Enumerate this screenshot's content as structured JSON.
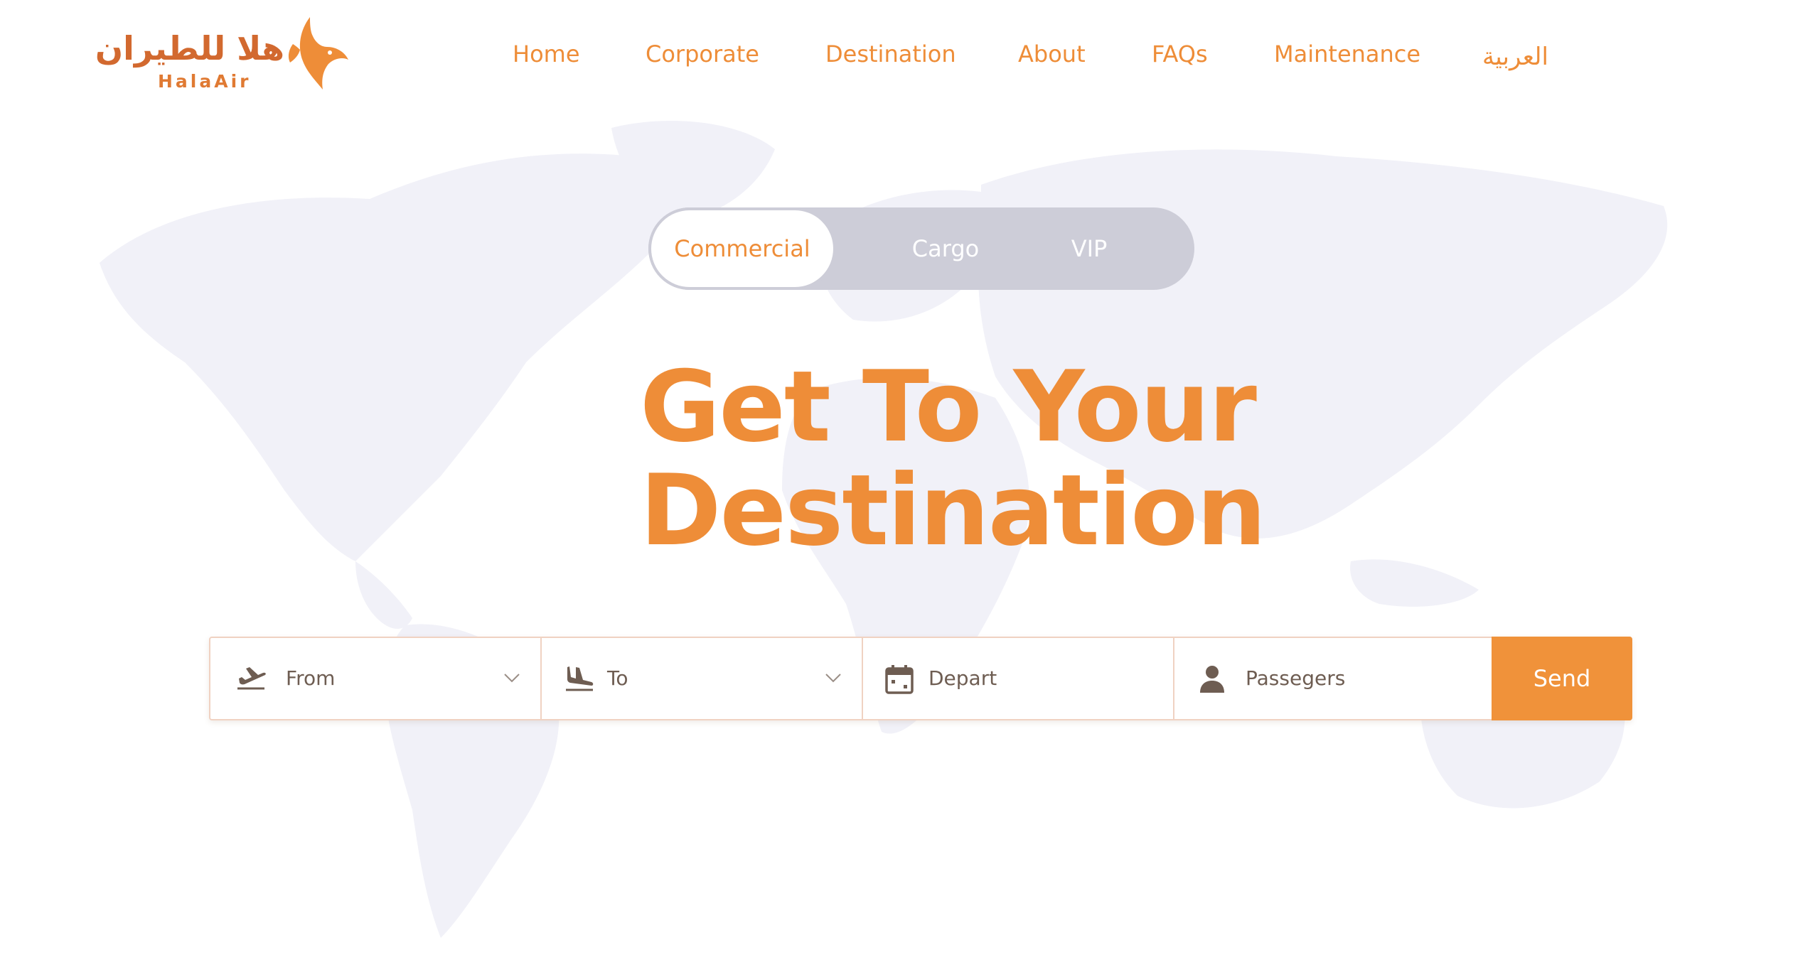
{
  "brand": {
    "name_arabic": "هلا للطيران",
    "name_latin": "HalaAir"
  },
  "nav": {
    "home": "Home",
    "corporate": "Corporate",
    "destination": "Destination",
    "about": "About",
    "faqs": "FAQs",
    "maintenance": "Maintenance",
    "language": "العربية"
  },
  "tabs": {
    "commercial": "Commercial",
    "cargo": "Cargo",
    "vip": "VIP",
    "active": "Commercial"
  },
  "hero": {
    "line1": "Get To Your",
    "line2": "Destination"
  },
  "search": {
    "from": "From",
    "to": "To",
    "depart": "Depart",
    "passengers": "Passegers",
    "send": "Send"
  },
  "colors": {
    "accent": "#ee8d38",
    "button": "#f0923a",
    "tab_track": "#cdcdd8",
    "map": "#f1f1f8",
    "field_text": "#6e5d52"
  },
  "icons": {
    "from": "plane-departure-icon",
    "to": "plane-arrival-icon",
    "depart": "calendar-icon",
    "passengers": "person-icon",
    "dropdown": "chevron-down-icon"
  }
}
